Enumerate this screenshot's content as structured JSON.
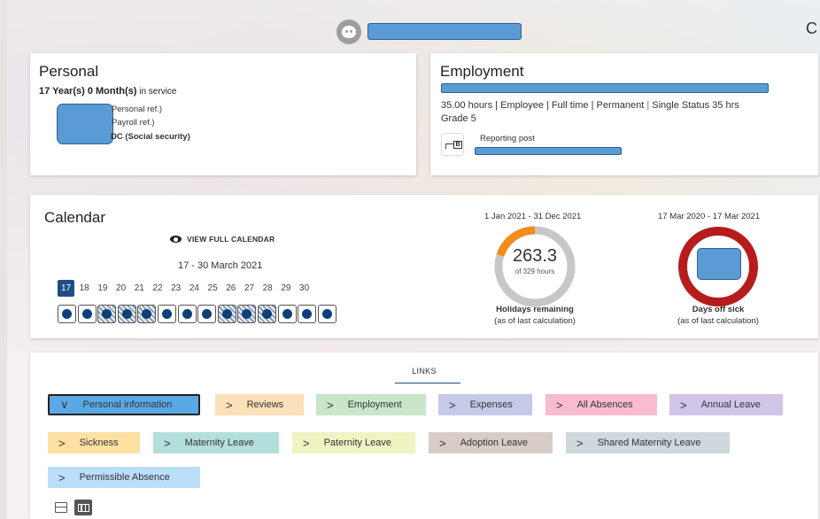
{
  "header": {
    "avatar_icon": "user-avatar-icon",
    "refresh_icon": "refresh-icon",
    "refresh_glyph": "C"
  },
  "personal": {
    "title": "Personal",
    "service_bold": "17 Year(s) 0 Month(s)",
    "service_suffix": "in service",
    "refs": [
      "Personal ref.)",
      "Payroll ref.)"
    ],
    "social_security": "DC (Social security)"
  },
  "employment": {
    "title": "Employment",
    "details_line1": "35.00 hours | Employee | Full time | Permanent",
    "details_line1b": "Single Status 35 hrs",
    "details_line2": "Grade 5",
    "reporting_icon_text": "B",
    "reporting_label": "Reporting post"
  },
  "calendar": {
    "title": "Calendar",
    "view_full": "VIEW FULL CALENDAR",
    "range": "17 - 30 March 2021",
    "days": [
      "17",
      "18",
      "19",
      "20",
      "21",
      "22",
      "23",
      "24",
      "25",
      "26",
      "27",
      "28",
      "29",
      "30"
    ],
    "today_index": 0,
    "hatched_days": [
      2,
      3,
      4,
      8,
      9,
      10
    ],
    "holidays": {
      "period": "1 Jan 2021 - 31 Dec 2021",
      "value": "263.3",
      "of_text": "of 329 hours",
      "label": "Holidays remaining",
      "sub": "(as of last calculation)",
      "remaining_fraction": 0.8,
      "colors": {
        "used": "#f28c1a",
        "remaining": "#c7c7c7"
      }
    },
    "sickness": {
      "period": "17 Mar 2020 - 17 Mar 2021",
      "label": "Days off sick",
      "sub": "(as of last calculation)",
      "ring_color": "#b71c1c"
    }
  },
  "links": {
    "title": "LINKS",
    "chips": [
      {
        "label": "Personal information",
        "color": "#5aa9e6",
        "selected": true,
        "chev": "∨"
      },
      {
        "label": "Reviews",
        "color": "#fbe0b8",
        "chev": ">"
      },
      {
        "label": "Employment",
        "color": "#c8e6c9",
        "chev": ">"
      },
      {
        "label": "Expenses",
        "color": "#c5cae9",
        "chev": ">"
      },
      {
        "label": "All Absences",
        "color": "#f8bbd0",
        "chev": ">"
      },
      {
        "label": "Annual Leave",
        "color": "#d1c4e9",
        "chev": ">"
      },
      {
        "label": "Sickness",
        "color": "#ffe0a3",
        "chev": ">"
      },
      {
        "label": "Maternity Leave",
        "color": "#b2dfdb",
        "chev": ">"
      },
      {
        "label": "Paternity Leave",
        "color": "#f0f4c3",
        "chev": ">"
      },
      {
        "label": "Adoption Leave",
        "color": "#d7ccc8",
        "chev": ">"
      },
      {
        "label": "Shared Maternity Leave",
        "color": "#cfd8dc",
        "chev": ">"
      },
      {
        "label": "Permissible Absence",
        "color": "#bbdefb",
        "chev": ">"
      }
    ]
  }
}
